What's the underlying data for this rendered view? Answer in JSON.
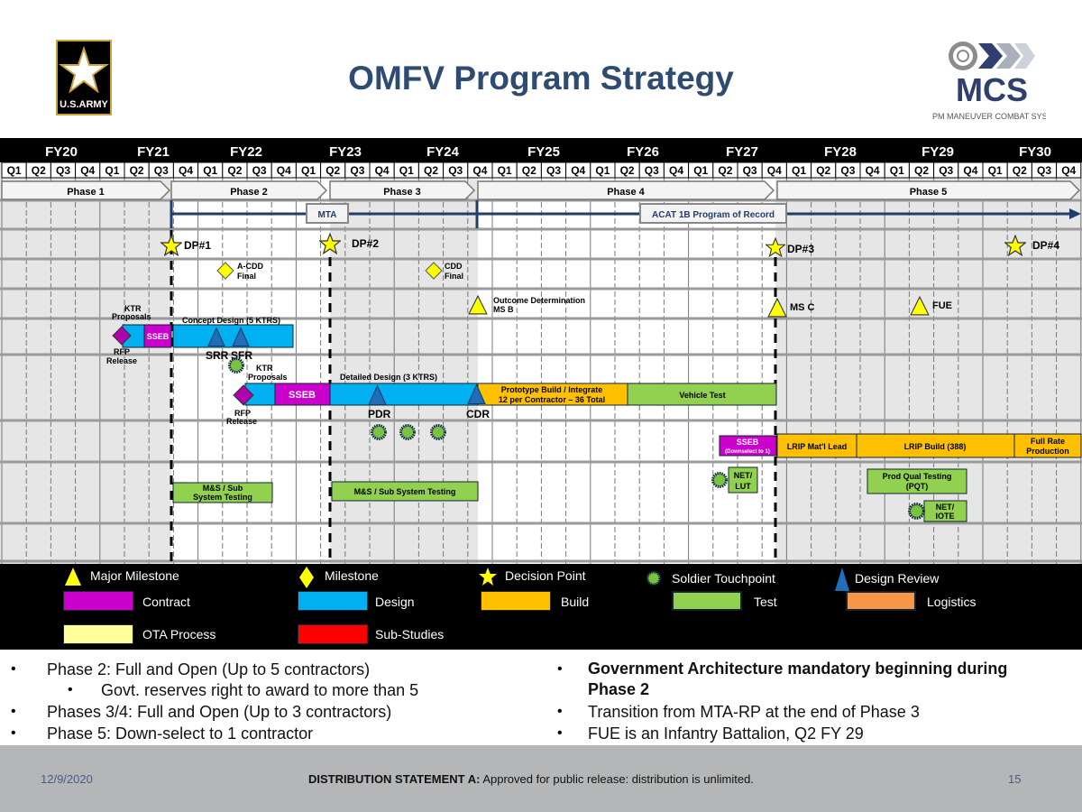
{
  "header": {
    "title": "OMFV Program Strategy",
    "army_logo_text": "U.S.ARMY",
    "mcs_logo_text": "MCS",
    "mcs_logo_sub": "PM MANEUVER COMBAT SYSTEMS"
  },
  "timeline": {
    "fiscal_years": [
      "FY20",
      "FY21",
      "FY22",
      "FY23",
      "FY24",
      "FY25",
      "FY26",
      "FY27",
      "FY28",
      "FY29",
      "FY30"
    ],
    "quarters": [
      "Q1",
      "Q2",
      "Q3",
      "Q4",
      "Q1",
      "Q2",
      "Q3",
      "Q4",
      "Q1",
      "Q2",
      "Q3",
      "Q4",
      "Q1",
      "Q2",
      "Q3",
      "Q4",
      "Q1",
      "Q2",
      "Q3",
      "Q4",
      "Q1",
      "Q2",
      "Q3",
      "Q4",
      "Q1",
      "Q2",
      "Q3",
      "Q4",
      "Q1",
      "Q2",
      "Q3",
      "Q4",
      "Q1",
      "Q2",
      "Q3",
      "Q4",
      "Q1",
      "Q2",
      "Q3",
      "Q4",
      "Q1",
      "Q2",
      "Q3",
      "Q4"
    ],
    "phases": [
      "Phase 1",
      "Phase 2",
      "Phase 3",
      "Phase 4",
      "Phase 5"
    ],
    "mta_label": "MTA",
    "acat_label": "ACAT 1B Program of Record",
    "decision_points": [
      "DP#1",
      "DP#2",
      "DP#3",
      "DP#4"
    ],
    "milestones": {
      "acdd_1": "A-CDD",
      "acdd_2": "Final",
      "cdd_1": "CDD",
      "cdd_2": "Final"
    },
    "major_milestones": {
      "msb_1": "Outcome Determination",
      "msb_2": "MS B",
      "msc": "MS C",
      "fue": "FUE"
    },
    "row_concept": {
      "ktr_1": "KTR",
      "ktr_2": "Proposals",
      "rfp_1": "RFP",
      "rfp_2": "Release",
      "sseb": "SSEB",
      "concept": "Concept Design (5 KTRS)",
      "srr": "SRR",
      "sfr": "SFR"
    },
    "row_detailed": {
      "ktr_1": "KTR",
      "ktr_2": "Proposals",
      "rfp_1": "RFP",
      "rfp_2": "Release",
      "sseb": "SSEB",
      "detailed": "Detailed Design (3 KTRS)",
      "pdr": "PDR",
      "cdr": "CDR",
      "proto_1": "Prototype Build / Integrate",
      "proto_2": "12 per Contractor – 36 Total",
      "vehicle_test": "Vehicle Test"
    },
    "row_production": {
      "sseb": "SSEB",
      "sseb_sub": "(Downselect to 1)",
      "lrip_lead": "LRIP Mat'l Lead",
      "lrip_build": "LRIP Build (388)",
      "frp_1": "Full Rate",
      "frp_2": "Production"
    },
    "row_test": {
      "ms1_1": "M&S / Sub",
      "ms1_2": "System Testing",
      "ms2": "M&S / Sub System Testing",
      "netlut_1": "NET/",
      "netlut_2": "LUT",
      "pqt_1": "Prod Qual Testing",
      "pqt_2": "(PQT)",
      "netiote_1": "NET/",
      "netiote_2": "IOTE"
    }
  },
  "legend": {
    "major_milestone": "Major Milestone",
    "milestone": "Milestone",
    "decision_point": "Decision Point",
    "soldier_touchpoint": "Soldier Touchpoint",
    "design_review": "Design Review",
    "contract": "Contract",
    "design": "Design",
    "build": "Build",
    "test": "Test",
    "logistics": "Logistics",
    "ota": "OTA Process",
    "sub_studies": "Sub-Studies"
  },
  "colors": {
    "contract": "#cc00cc",
    "design": "#00b0f0",
    "build": "#ffc000",
    "test": "#92d050",
    "logistics": "#f79646",
    "ota": "#ffff99",
    "sub_studies": "#ff0000",
    "title": "#2f4b72",
    "program_line": "#1f3e6e"
  },
  "bullets_left": [
    "Phase 2: Full and Open (Up to 5 contractors)",
    "Govt. reserves right to award to more than 5",
    "Phases 3/4: Full and Open (Up to 3 contractors)",
    "Phase 5: Down-select to 1 contractor"
  ],
  "bullets_right": {
    "b1_line1": "Government Architecture mandatory beginning during",
    "b1_line2": "Phase 2",
    "b2": "Transition from MTA-RP at the end of Phase 3",
    "b3": "FUE is an Infantry Battalion, Q2 FY 29"
  },
  "footer": {
    "date": "12/9/2020",
    "statement_bold": "DISTRIBUTION STATEMENT A:",
    "statement": " Approved for public release: distribution is unlimited.",
    "page": "15"
  }
}
